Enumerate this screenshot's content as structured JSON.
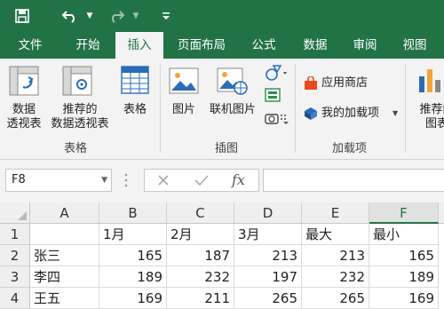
{
  "ribbon_tabs": [
    {
      "label": "文件"
    },
    {
      "label": "开始"
    },
    {
      "label": "插入"
    },
    {
      "label": "页面布局"
    },
    {
      "label": "公式"
    },
    {
      "label": "数据"
    },
    {
      "label": "审阅"
    },
    {
      "label": "视图"
    }
  ],
  "active_tab": "插入",
  "ribbon": {
    "tables": {
      "pivot_line1": "数据",
      "pivot_line2": "透视表",
      "recommended_line1": "推荐的",
      "recommended_line2": "数据透视表",
      "table": "表格",
      "group": "表格"
    },
    "illustrations": {
      "pictures": "图片",
      "online_pictures": "联机图片",
      "group": "插图"
    },
    "addins": {
      "store": "应用商店",
      "my_addins": "我的加载项",
      "group": "加载项"
    },
    "charts": {
      "recommended_line1": "推荐的",
      "recommended_line2": "图表"
    }
  },
  "formula_bar": {
    "name_box": "F8",
    "fx": "fx",
    "formula": ""
  },
  "sheet": {
    "columns": [
      "A",
      "B",
      "C",
      "D",
      "E",
      "F"
    ],
    "selected_column": "F",
    "rows": [
      {
        "num": "1",
        "cells": [
          "",
          "1月",
          "2月",
          "3月",
          "最大",
          "最小"
        ]
      },
      {
        "num": "2",
        "cells": [
          "张三",
          "165",
          "187",
          "213",
          "213",
          "165"
        ]
      },
      {
        "num": "3",
        "cells": [
          "李四",
          "189",
          "232",
          "197",
          "232",
          "189"
        ]
      },
      {
        "num": "4",
        "cells": [
          "王五",
          "169",
          "211",
          "265",
          "265",
          "169"
        ]
      }
    ]
  },
  "colors": {
    "accent": "#217346",
    "store_icon": "#e84a1c",
    "addin_icon": "#2b6cb8"
  }
}
